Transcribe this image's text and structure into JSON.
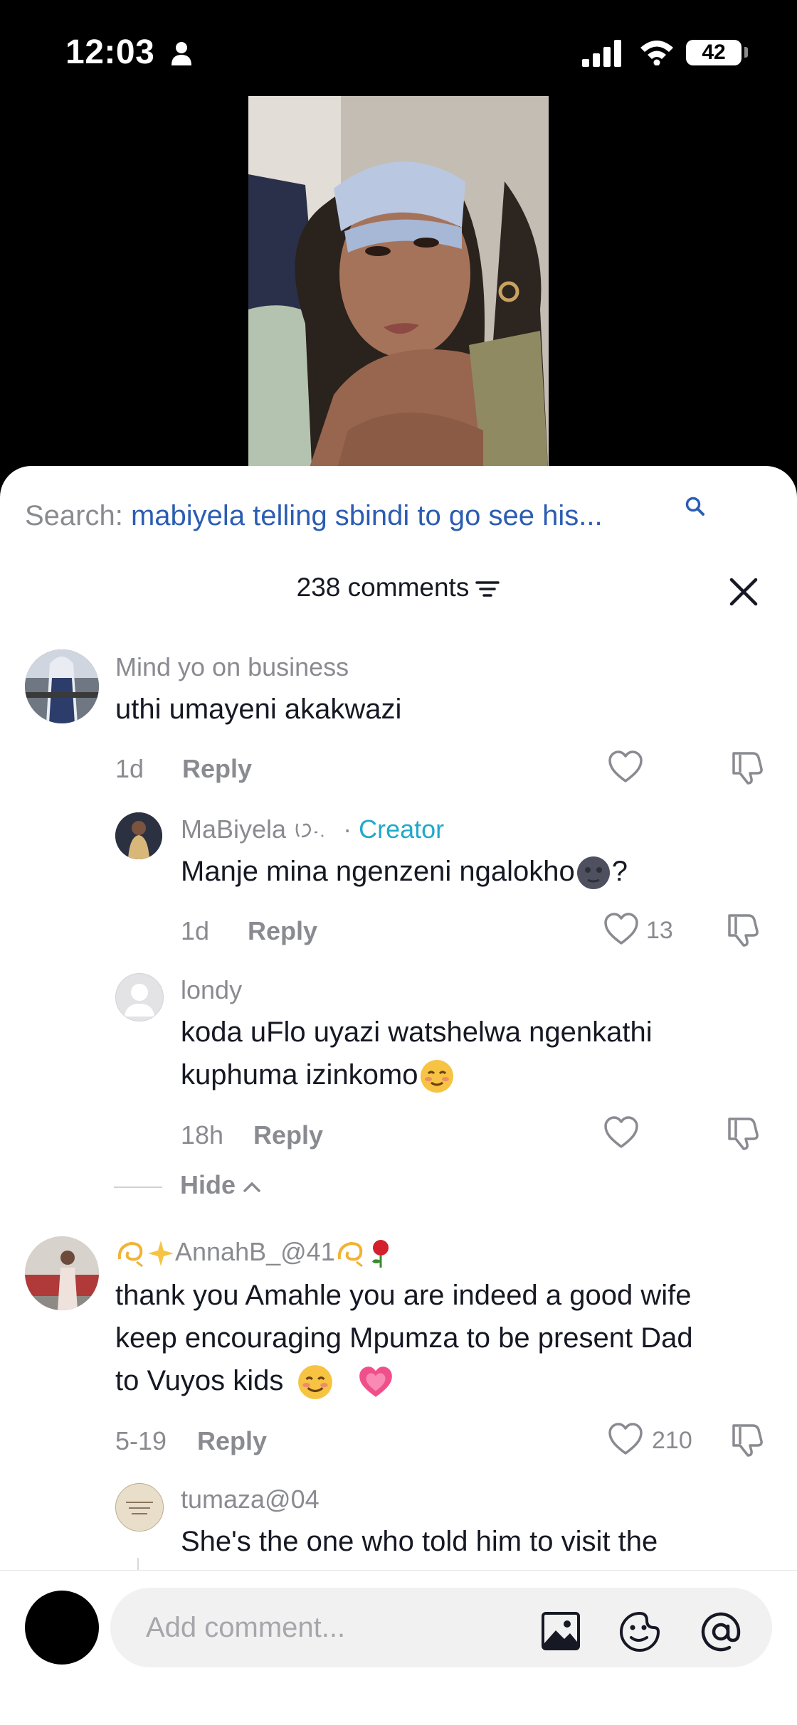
{
  "status_bar": {
    "time": "12:03",
    "battery": "42"
  },
  "search": {
    "label": "Search:",
    "query": "mabiyela telling sbindi to go see his..."
  },
  "comments_header": {
    "count_label": "238 comments"
  },
  "comments": [
    {
      "username": "Mind yo on business",
      "text": "uthi umayeni akakwazi",
      "age": "1d",
      "reply": "Reply"
    },
    {
      "username": "MaBiyela",
      "username_suffix": "·",
      "creator_label": "Creator",
      "text": "Manje mina ngenzeni ngalokho",
      "text_suffix": "?",
      "age": "1d",
      "reply": "Reply",
      "likes": "13"
    },
    {
      "username": "londy",
      "text_line1": "koda uFlo uyazi watshelwa ngenkathi",
      "text_line2": "kuphuma izinkomo",
      "age": "18h",
      "reply": "Reply"
    },
    {
      "username": "AnnahB_@41",
      "text_line1": "thank you Amahle you are indeed a good wife",
      "text_line2": "keep encouraging Mpumza to be present Dad",
      "text_line3": "to Vuyos kids",
      "age": "5-19",
      "reply": "Reply",
      "likes": "210"
    },
    {
      "username": "tumaza@04",
      "text": "She's the one who told him to visit the"
    }
  ],
  "hide_label": "Hide",
  "footer": {
    "placeholder": "Add comment..."
  },
  "icons": [
    "person-icon",
    "signal-icon",
    "wifi-icon",
    "search-icon",
    "filter-icon",
    "close-icon",
    "heart-icon",
    "dislike-icon",
    "image-icon",
    "sticker-icon",
    "mention-icon",
    "chevron-up-icon"
  ],
  "colors": {
    "accent_blue": "#2b5db2",
    "creator": "#20a9c9",
    "muted": "#8a8b91"
  }
}
